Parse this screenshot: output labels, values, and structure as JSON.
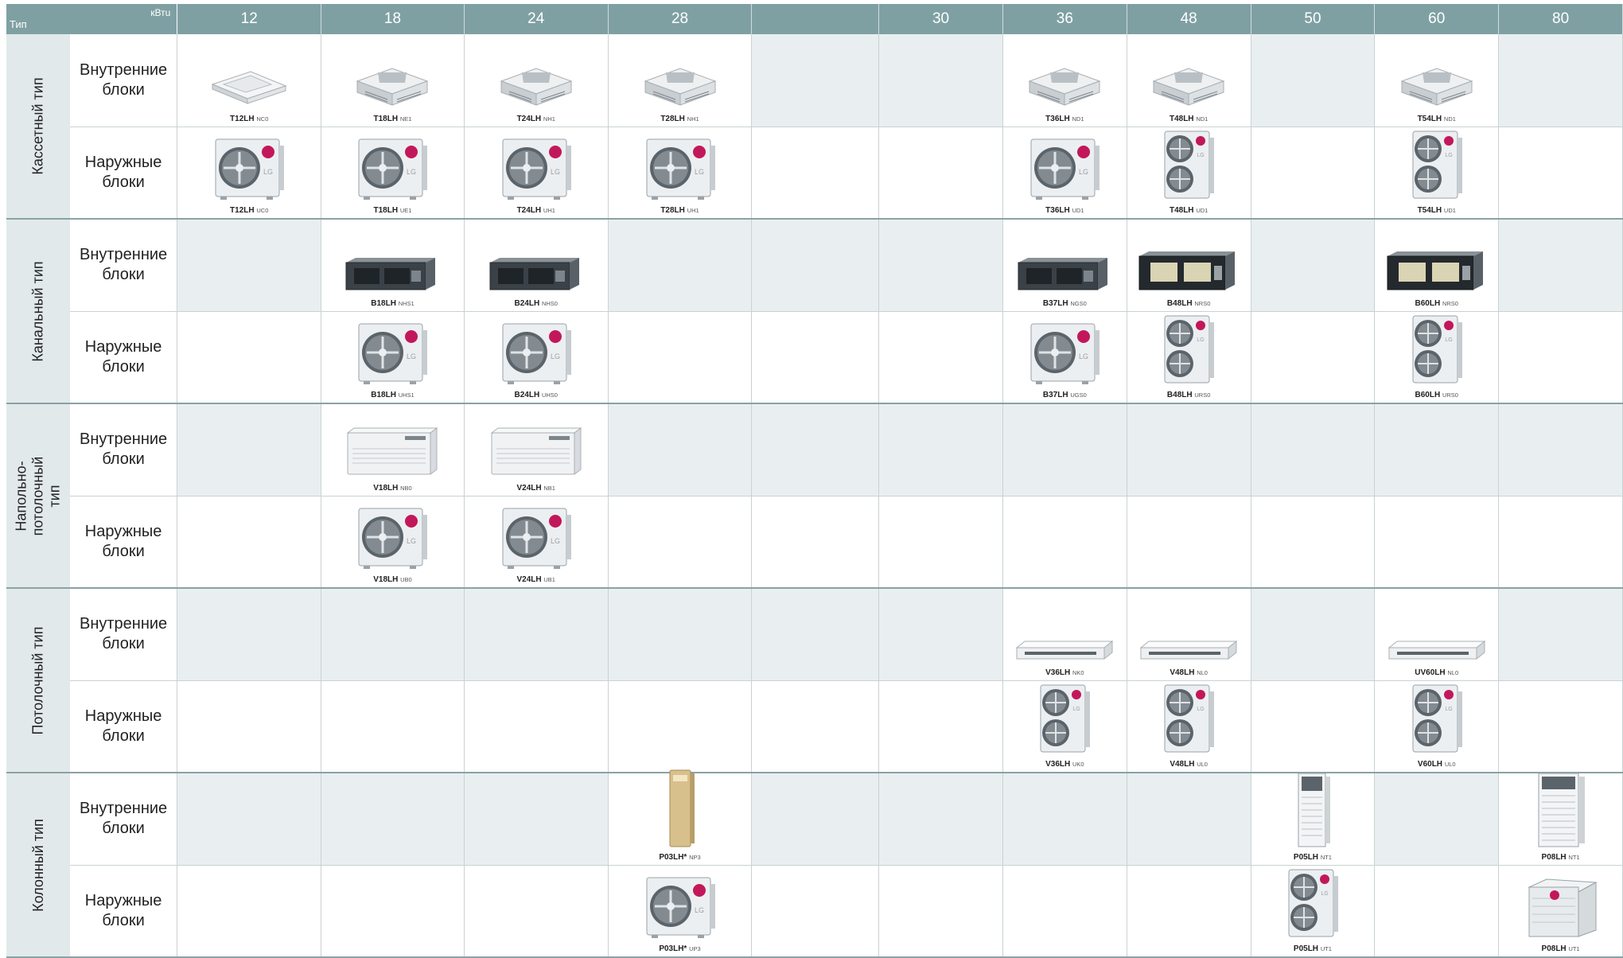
{
  "header": {
    "type_label": "Тип",
    "unit_label": "кВтu",
    "capacities": [
      "12",
      "18",
      "24",
      "28",
      "",
      "30",
      "36",
      "48",
      "50",
      "60",
      "80"
    ]
  },
  "row_labels": {
    "indoor": "Внутренние блоки",
    "outdoor": "Наружные блоки"
  },
  "groups": [
    {
      "name": "Кассетный тип",
      "indoor": [
        {
          "c": 0,
          "k": "cassette-small",
          "m": "T12LH",
          "s": "NC0"
        },
        {
          "c": 1,
          "k": "cassette",
          "m": "T18LH",
          "s": "NE1"
        },
        {
          "c": 2,
          "k": "cassette",
          "m": "T24LH",
          "s": "NH1"
        },
        {
          "c": 3,
          "k": "cassette",
          "m": "T28LH",
          "s": "NH1"
        },
        {
          "c": 6,
          "k": "cassette",
          "m": "T36LH",
          "s": "ND1"
        },
        {
          "c": 7,
          "k": "cassette",
          "m": "T48LH",
          "s": "ND1"
        },
        {
          "c": 9,
          "k": "cassette",
          "m": "T54LH",
          "s": "ND1"
        }
      ],
      "outdoor": [
        {
          "c": 0,
          "k": "outdoor-single",
          "m": "T12LH",
          "s": "UC0"
        },
        {
          "c": 1,
          "k": "outdoor-single",
          "m": "T18LH",
          "s": "UE1"
        },
        {
          "c": 2,
          "k": "outdoor-single",
          "m": "T24LH",
          "s": "UH1"
        },
        {
          "c": 3,
          "k": "outdoor-single",
          "m": "T28LH",
          "s": "UH1"
        },
        {
          "c": 6,
          "k": "outdoor-single",
          "m": "T36LH",
          "s": "UD1"
        },
        {
          "c": 7,
          "k": "outdoor-double",
          "m": "T48LH",
          "s": "UD1"
        },
        {
          "c": 9,
          "k": "outdoor-double",
          "m": "T54LH",
          "s": "UD1"
        }
      ]
    },
    {
      "name": "Канальный тип",
      "indoor": [
        {
          "c": 1,
          "k": "duct",
          "m": "B18LH",
          "s": "NHS1"
        },
        {
          "c": 2,
          "k": "duct",
          "m": "B24LH",
          "s": "NHS0"
        },
        {
          "c": 6,
          "k": "duct",
          "m": "B37LH",
          "s": "NGS0"
        },
        {
          "c": 7,
          "k": "duct-large",
          "m": "B48LH",
          "s": "NRS0"
        },
        {
          "c": 9,
          "k": "duct-large",
          "m": "B60LH",
          "s": "NRS0"
        }
      ],
      "outdoor": [
        {
          "c": 1,
          "k": "outdoor-single",
          "m": "B18LH",
          "s": "UHS1"
        },
        {
          "c": 2,
          "k": "outdoor-single",
          "m": "B24LH",
          "s": "UHS0"
        },
        {
          "c": 6,
          "k": "outdoor-single",
          "m": "B37LH",
          "s": "UGS0"
        },
        {
          "c": 7,
          "k": "outdoor-double",
          "m": "B48LH",
          "s": "URS0"
        },
        {
          "c": 9,
          "k": "outdoor-double",
          "m": "B60LH",
          "s": "URS0"
        }
      ]
    },
    {
      "name": "Напольно-потолочный тип",
      "indoor": [
        {
          "c": 1,
          "k": "floor-ceiling",
          "m": "V18LH",
          "s": "NB0"
        },
        {
          "c": 2,
          "k": "floor-ceiling",
          "m": "V24LH",
          "s": "NB1"
        }
      ],
      "outdoor": [
        {
          "c": 1,
          "k": "outdoor-single",
          "m": "V18LH",
          "s": "UB0"
        },
        {
          "c": 2,
          "k": "outdoor-single",
          "m": "V24LH",
          "s": "UB1"
        }
      ]
    },
    {
      "name": "Потолочный тип",
      "indoor": [
        {
          "c": 6,
          "k": "ceiling",
          "m": "V36LH",
          "s": "NK0"
        },
        {
          "c": 7,
          "k": "ceiling",
          "m": "V48LH",
          "s": "NL0"
        },
        {
          "c": 9,
          "k": "ceiling",
          "m": "UV60LH",
          "s": "NL0"
        }
      ],
      "outdoor": [
        {
          "c": 6,
          "k": "outdoor-double",
          "m": "V36LH",
          "s": "UK0"
        },
        {
          "c": 7,
          "k": "outdoor-double",
          "m": "V48LH",
          "s": "UL0"
        },
        {
          "c": 9,
          "k": "outdoor-double",
          "m": "V60LH",
          "s": "UL0"
        }
      ]
    },
    {
      "name": "Колонный тип",
      "indoor": [
        {
          "c": 3,
          "k": "column-gold",
          "m": "P03LH*",
          "s": "NP3"
        },
        {
          "c": 8,
          "k": "column",
          "m": "P05LH",
          "s": "NT1"
        },
        {
          "c": 10,
          "k": "column-wide",
          "m": "P08LH",
          "s": "NT1"
        }
      ],
      "outdoor": [
        {
          "c": 3,
          "k": "outdoor-single",
          "m": "P03LH*",
          "s": "UP3"
        },
        {
          "c": 8,
          "k": "outdoor-double",
          "m": "P05LH",
          "s": "UT1"
        },
        {
          "c": 10,
          "k": "outdoor-box",
          "m": "P08LH",
          "s": "UT1"
        }
      ]
    }
  ]
}
